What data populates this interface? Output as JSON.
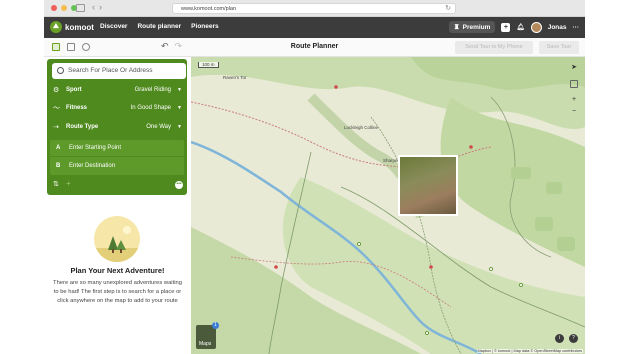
{
  "browser": {
    "url": "www.komoot.com/plan",
    "traffic_colors": [
      "#ee5f57",
      "#f5bd4f",
      "#61c454"
    ]
  },
  "header": {
    "brand": "komoot",
    "nav": [
      "Discover",
      "Route planner",
      "Pioneers"
    ],
    "premium_label": "Premium",
    "user_name": "Jonas",
    "more_label": "···"
  },
  "toolbar": {
    "title": "Route Planner",
    "send_label": "Send Tour to My Phone",
    "save_label": "Save Tour"
  },
  "planner": {
    "search_placeholder": "Search For Place Or Address",
    "sport_label": "Sport",
    "sport_value": "Gravel Riding",
    "fitness_label": "Fitness",
    "fitness_value": "In Good Shape",
    "route_type_label": "Route Type",
    "route_type_value": "One Way",
    "start_letter": "A",
    "start_placeholder": "Enter Starting Point",
    "dest_letter": "B",
    "dest_placeholder": "Enter Destination"
  },
  "empty_state": {
    "title": "Plan Your Next Adventure!",
    "text": "There are so many unexplored adventures waiting to be had! The first step is to search for a place or click anywhere on the map to add to your route"
  },
  "map": {
    "scale": "100 m",
    "labels": [
      "Raven's Tor",
      "Lockleigh Colline",
      "Sharpes"
    ],
    "layers_label": "Maps",
    "layers_badge": "1",
    "attribution": "Mapbox | © komoot | Map data © OpenStreetMap contributors",
    "accent": "#4f8a1e"
  }
}
